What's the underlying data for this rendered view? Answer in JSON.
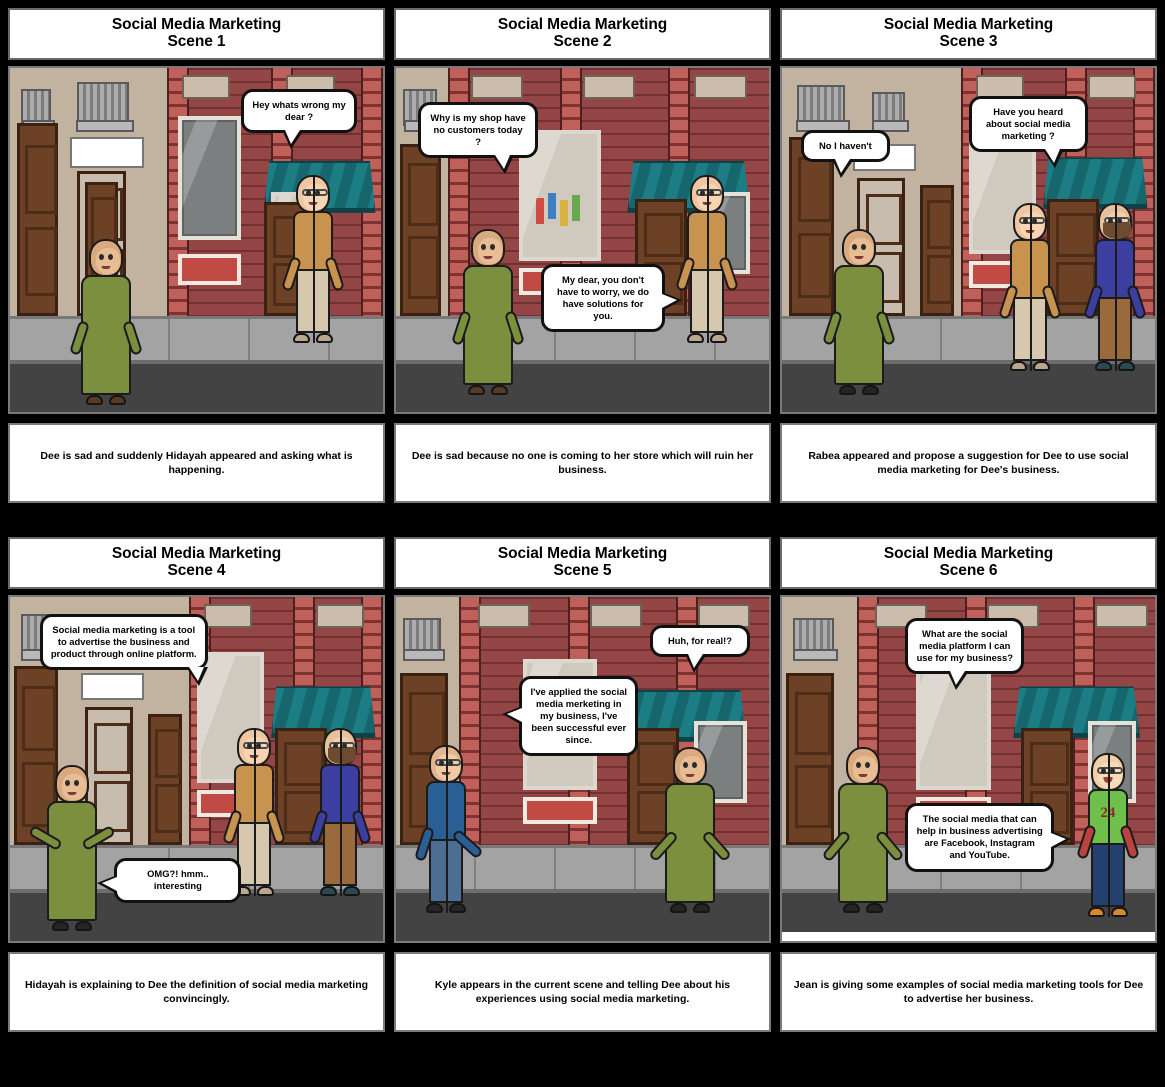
{
  "storyboard": {
    "title": "Social Media Marketing",
    "panels": [
      {
        "id": "scene-1",
        "title": "Social Media Marketing",
        "scene_label": "Scene 1",
        "caption": "Dee is sad and suddenly Hidayah appeared and asking what is happening.",
        "bubbles": [
          {
            "name": "bubble-hey-whats-wrong",
            "text": "Hey whats wrong my dear ?"
          }
        ],
        "characters": [
          {
            "name": "dee",
            "hijab_color": "#9e5a63",
            "outfit_color": "#7c8f3e",
            "skin": "#d9a97f"
          },
          {
            "name": "hidayah",
            "hijab_color": "#ef9a75",
            "outfit_color": "#c8924f",
            "skin": "#f0c5a2"
          }
        ]
      },
      {
        "id": "scene-2",
        "title": "Social Media Marketing",
        "scene_label": "Scene 2",
        "caption": "Dee is sad because no one is coming to her store which will ruin her business.",
        "bubbles": [
          {
            "name": "bubble-why-no-customers",
            "text": "Why is my shop have no customers today ?"
          },
          {
            "name": "bubble-dont-worry",
            "text": "My dear, you don't have to worry, we do have solutions for you."
          }
        ],
        "characters": [
          {
            "name": "dee",
            "hijab_color": "#9e5a63",
            "outfit_color": "#7c8f3e",
            "skin": "#d9a97f"
          },
          {
            "name": "hidayah",
            "hijab_color": "#ef9a75",
            "outfit_color": "#c8924f",
            "skin": "#f0c5a2"
          }
        ]
      },
      {
        "id": "scene-3",
        "title": "Social Media Marketing",
        "scene_label": "Scene 3",
        "caption": "Rabea appeared and propose a suggestion for Dee to use social media marketing for Dee's business.",
        "bubbles": [
          {
            "name": "bubble-no-i-havent",
            "text": "No I haven't"
          },
          {
            "name": "bubble-heard-about-smm",
            "text": "Have you heard about social media marketing ?"
          }
        ],
        "characters": [
          {
            "name": "dee",
            "hijab_color": "#9e5a63",
            "outfit_color": "#7c8f3e",
            "skin": "#d9a97f"
          },
          {
            "name": "hidayah",
            "hijab_color": "#ef9a75",
            "outfit_color": "#c8924f",
            "skin": "#f0c5a2"
          },
          {
            "name": "rabea",
            "hair_color": "#6e4a2f",
            "outfit_color": "#3d3fa0",
            "skin": "#e8c09a"
          }
        ]
      },
      {
        "id": "scene-4",
        "title": "Social Media Marketing",
        "scene_label": "Scene 4",
        "caption": "Hidayah is explaining to Dee the definition of social media marketing convincingly.",
        "bubbles": [
          {
            "name": "bubble-smm-definition",
            "text": "Social media marketing is a tool to advertise the business and product through online platform."
          },
          {
            "name": "bubble-omg-interesting",
            "text": "OMG?! hmm.. interesting"
          }
        ],
        "characters": [
          {
            "name": "dee",
            "hijab_color": "#9e5a63",
            "outfit_color": "#7c8f3e",
            "skin": "#d9a97f"
          },
          {
            "name": "hidayah",
            "hijab_color": "#ef9a75",
            "outfit_color": "#c8924f",
            "skin": "#f0c5a2"
          },
          {
            "name": "rabea",
            "hair_color": "#6e4a2f",
            "outfit_color": "#3d3fa0",
            "skin": "#e8c09a"
          }
        ]
      },
      {
        "id": "scene-5",
        "title": "Social Media Marketing",
        "scene_label": "Scene 5",
        "caption": "Kyle appears in the current scene and telling Dee about his experiences using social media marketing.",
        "bubbles": [
          {
            "name": "bubble-applied-smm",
            "text": "I've applied the social media merketing in my business, I've been successful ever since."
          },
          {
            "name": "bubble-huh-for-real",
            "text": "Huh, for real!?"
          }
        ],
        "characters": [
          {
            "name": "kyle",
            "hair_color": "#1b1b22",
            "outfit_color": "#2a5f96",
            "skin": "#e3b58e"
          },
          {
            "name": "dee",
            "hijab_color": "#9e5a63",
            "outfit_color": "#7c8f3e",
            "skin": "#d9a97f"
          }
        ]
      },
      {
        "id": "scene-6",
        "title": "Social Media Marketing",
        "scene_label": "Scene 6",
        "caption": "Jean is giving some examples of social media marketing tools for Dee to advertise her business.",
        "bubbles": [
          {
            "name": "bubble-which-platforms",
            "text": "What are the social media platform I can use for my business?"
          },
          {
            "name": "bubble-platform-list",
            "text": "The social media that can help in business advertising are Facebook, Instagram and YouTube."
          }
        ],
        "characters": [
          {
            "name": "dee",
            "hijab_color": "#9e5a63",
            "outfit_color": "#7c8f3e",
            "skin": "#d9a97f"
          },
          {
            "name": "jean",
            "hair_color": "#171717",
            "outfit_color": "#6ec04a",
            "jersey_number": "24",
            "skin": "#f0cfa9"
          }
        ]
      }
    ]
  },
  "colors": {
    "background": "#000000",
    "panel_border": "#7a7a7a",
    "box_fill": "#ffffff",
    "road": "#434343",
    "sidewalk": "#a3a3a3",
    "awning": "#1d7d85",
    "brick": "#b5504c",
    "left_building": "#c2b2a0"
  }
}
